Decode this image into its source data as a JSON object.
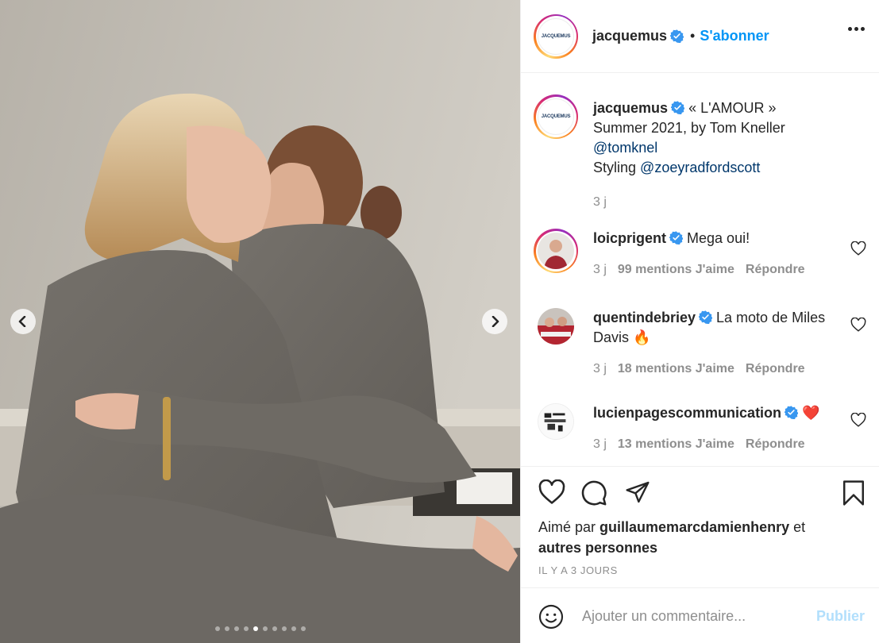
{
  "post": {
    "carousel": {
      "slide_count": 10,
      "active_slide": 5
    }
  },
  "header": {
    "avatar_text": "JACQUEMUS",
    "username": "jacquemus",
    "separator": "•",
    "follow_label": "S'abonner"
  },
  "caption": {
    "username": "jacquemus",
    "line1": "« L'AMOUR »",
    "line2": "Summer 2021, by Tom Kneller",
    "mention1": "@tomknel",
    "styling_label": "Styling",
    "mention2": "@zoeyradfordscott",
    "time": "3 j"
  },
  "comments": [
    {
      "username": "loicprigent",
      "text": "Mega oui!",
      "time": "3 j",
      "likes": "99 mentions J'aime",
      "reply": "Répondre"
    },
    {
      "username": "quentindebriey",
      "text": "La moto de Miles Davis 🔥",
      "time": "3 j",
      "likes": "18 mentions J'aime",
      "reply": "Répondre"
    },
    {
      "username": "lucienpagescommunication",
      "text": "❤️",
      "time": "3 j",
      "likes": "13 mentions J'aime",
      "reply": "Répondre"
    }
  ],
  "likes": {
    "prefix": "Aimé par",
    "user": "guillaumemarcdamienhenry",
    "mid": "et",
    "others": "autres personnes"
  },
  "timestamp": "IL Y A 3 JOURS",
  "add_comment": {
    "placeholder": "Ajouter un commentaire...",
    "publish_label": "Publier"
  },
  "colors": {
    "accent": "#0095f6",
    "verified": "#3897f0",
    "link": "#00376b",
    "muted": "#8e8e8e"
  }
}
